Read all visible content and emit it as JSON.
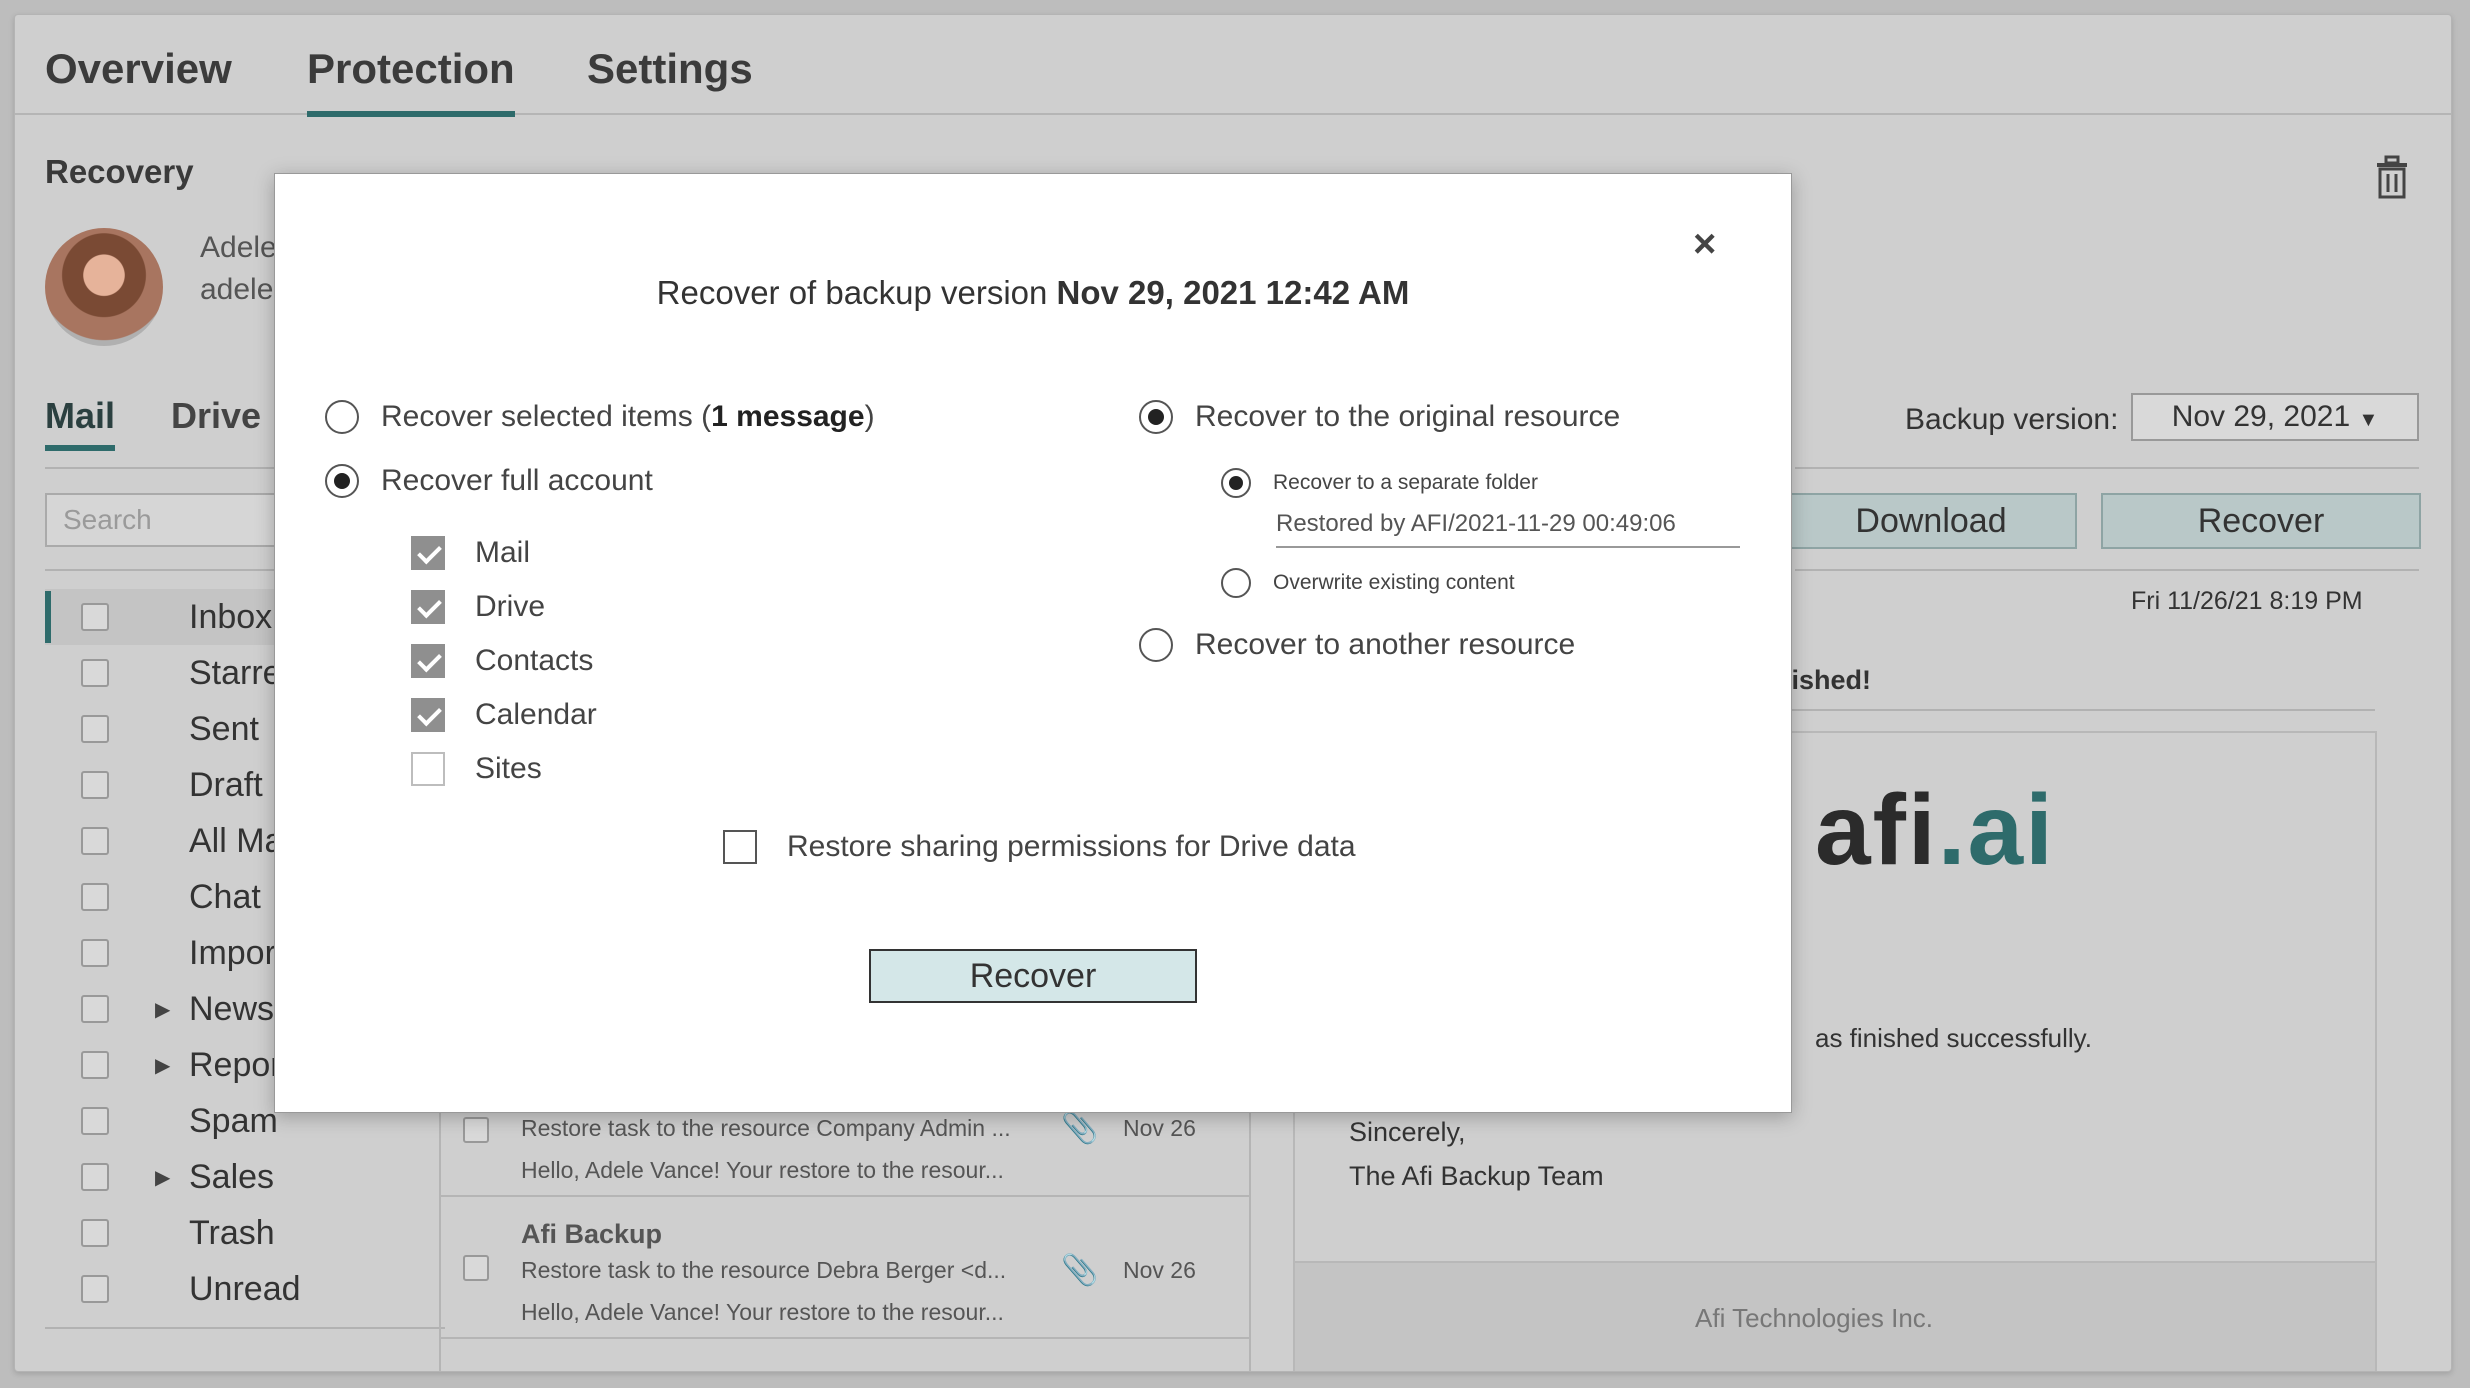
{
  "tabs": [
    "Overview",
    "Protection",
    "Settings"
  ],
  "section_title": "Recovery",
  "user": {
    "name": "Adele",
    "email": "adele."
  },
  "sub_tabs": [
    "Mail",
    "Drive"
  ],
  "search_placeholder": "Search",
  "folders": [
    {
      "label": "Inbox"
    },
    {
      "label": "Starred"
    },
    {
      "label": "Sent"
    },
    {
      "label": "Draft"
    },
    {
      "label": "All Mai"
    },
    {
      "label": "Chat"
    },
    {
      "label": "Import"
    },
    {
      "label": "News"
    },
    {
      "label": "Report"
    },
    {
      "label": "Spam"
    },
    {
      "label": "Sales"
    },
    {
      "label": "Trash"
    },
    {
      "label": "Unread"
    }
  ],
  "messages": [
    {
      "sender": "",
      "subject": "Restore task to the resource Company Admin ...",
      "preview": "Hello, Adele Vance! Your restore to the resour...",
      "date": "Nov 26"
    },
    {
      "sender": "Afi Backup",
      "subject": "Restore task to the resource Debra Berger <d...",
      "preview": "Hello, Adele Vance! Your restore to the resour...",
      "date": "Nov 26"
    }
  ],
  "backup_version": {
    "label": "Backup version:",
    "value": "Nov 29, 2021"
  },
  "actions": {
    "download": "Download",
    "recover": "Recover"
  },
  "preview": {
    "date": "Fri 11/26/21 8:19 PM",
    "subject_fragment": "nished!",
    "logo_main": "afi",
    "logo_dot": ".ai",
    "body_fragment": "as finished successfully.",
    "sign_1": "Sincerely,",
    "sign_2": "The Afi Backup Team",
    "footer": "Afi Technologies Inc."
  },
  "modal": {
    "close": "×",
    "title_prefix": "Recover of backup version ",
    "title_version": "Nov 29, 2021 12:42 AM",
    "opt_selected_prefix": "Recover selected items (",
    "opt_selected_bold": "1 message",
    "opt_selected_suffix": ")",
    "opt_full": "Recover full account",
    "services": [
      "Mail",
      "Drive",
      "Contacts",
      "Calendar",
      "Sites"
    ],
    "opt_original": "Recover to the original resource",
    "opt_separate": "Recover to a separate folder",
    "folder_value": "Restored by AFI/2021-11-29 00:49:06",
    "opt_overwrite": "Overwrite existing content",
    "opt_another": "Recover to another resource",
    "sharing": "Restore sharing permissions for Drive data",
    "recover_button": "Recover"
  }
}
